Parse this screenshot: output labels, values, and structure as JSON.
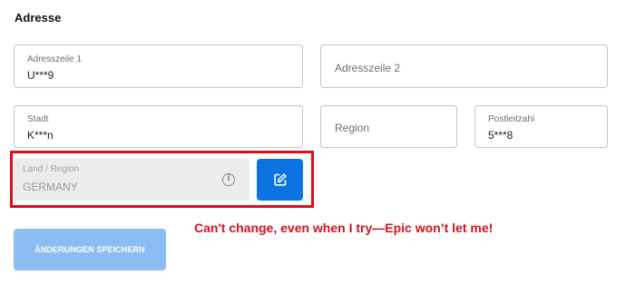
{
  "section": {
    "title": "Adresse"
  },
  "fields": {
    "address1": {
      "label": "Adresszeile 1",
      "value": "U***9"
    },
    "address2": {
      "placeholder": "Adresszeile 2"
    },
    "city": {
      "label": "Stadt",
      "value": "K***n"
    },
    "region": {
      "placeholder": "Region"
    },
    "postal": {
      "label": "Postleitzahl",
      "value": "5***8"
    },
    "country": {
      "label": "Land / Region",
      "value": "GERMANY"
    }
  },
  "annotation": {
    "text": "Can't change, even when I try—Epic won’t let me!",
    "color": "#d7101f"
  },
  "buttons": {
    "save_label": "ÄNDERUNGEN SPEICHERN"
  },
  "icons": {
    "info": "info-icon",
    "edit": "edit-icon"
  },
  "colors": {
    "primary": "#0d73e3",
    "primary_disabled": "#8cbdf2",
    "highlight": "#d7101f"
  }
}
